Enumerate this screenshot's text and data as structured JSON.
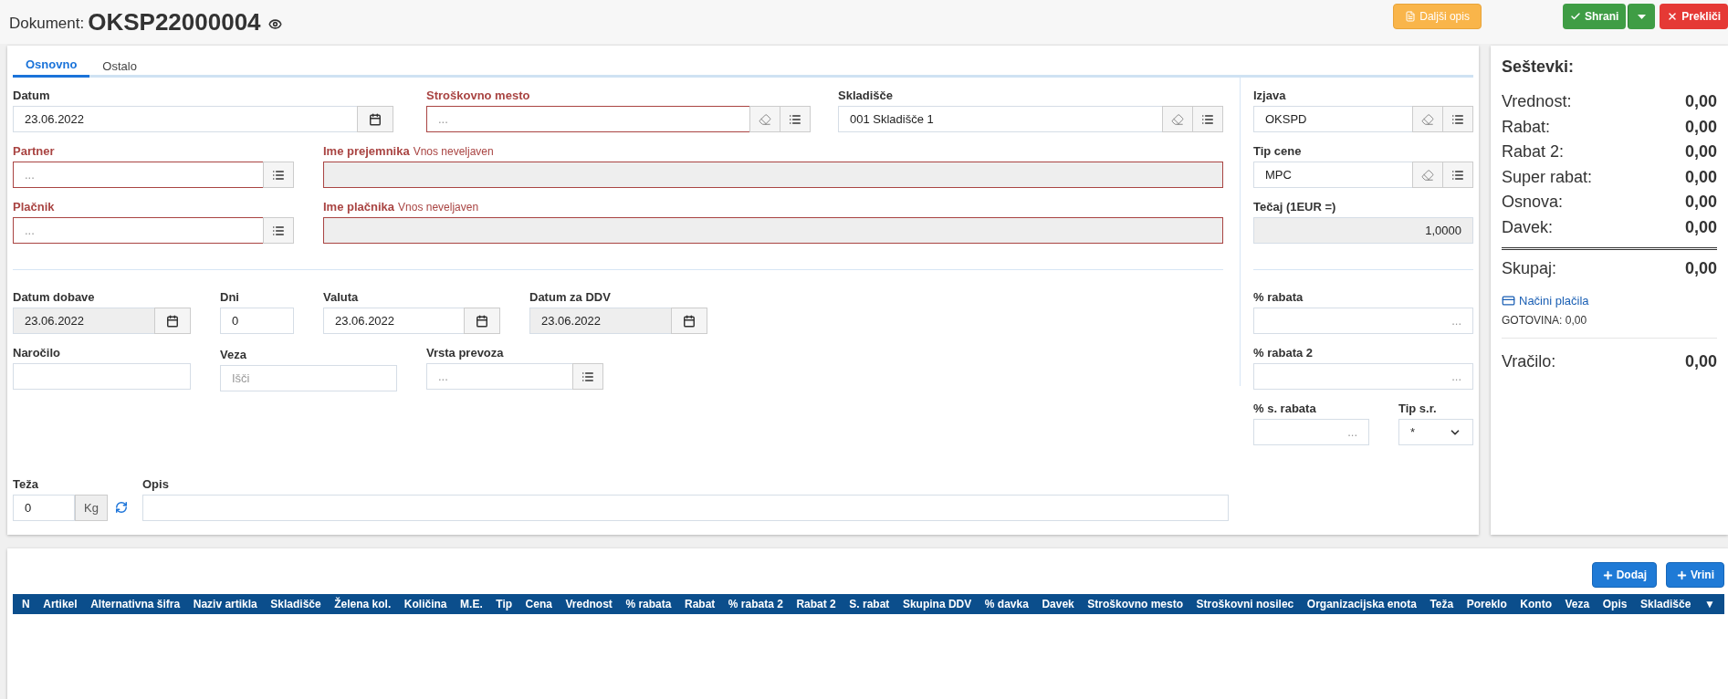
{
  "document": {
    "label": "Dokument:",
    "number": "OKSP22000004"
  },
  "header_buttons": [
    {
      "kind": "info",
      "label": "Daljši opis"
    },
    {
      "kind": "save",
      "label": "Shrani"
    },
    {
      "kind": "dropdown"
    },
    {
      "kind": "cancel",
      "label": "Prekliči"
    }
  ],
  "tabs": [
    {
      "label": "Osnovno",
      "selected": true
    },
    {
      "label": "Ostalo",
      "selected": false
    }
  ],
  "form": {
    "datum": {
      "label": "Datum",
      "value": "23.06.2022",
      "invalid": false,
      "readonly": false
    },
    "stroskovno_mesto": {
      "label": "Stroškovno mesto",
      "placeholder": "...",
      "invalid": true,
      "readonly": false
    },
    "skladisce": {
      "label": "Skladišče",
      "value": "001 Skladišče 1",
      "invalid": false,
      "readonly": false
    },
    "partner": {
      "label": "Partner",
      "placeholder": "...",
      "invalid": true,
      "readonly": false
    },
    "ime_prejemnika": {
      "label": "Ime prejemnika",
      "note": "Vnos neveljaven",
      "invalid": true,
      "readonly": true
    },
    "placnik": {
      "label": "Plačnik",
      "placeholder": "...",
      "invalid": true,
      "readonly": false
    },
    "ime_placnika": {
      "label": "Ime plačnika",
      "note": "Vnos neveljaven",
      "invalid": true,
      "readonly": true
    },
    "datum_dobave": {
      "label": "Datum dobave",
      "value": "23.06.2022",
      "invalid": false,
      "readonly": true
    },
    "dni": {
      "label": "Dni",
      "value": "0",
      "invalid": false,
      "readonly": false
    },
    "valuta": {
      "label": "Valuta",
      "value": "23.06.2022",
      "invalid": false,
      "readonly": false
    },
    "datum_za_ddv": {
      "label": "Datum za DDV",
      "value": "23.06.2022",
      "invalid": false,
      "readonly": true
    },
    "narocilo": {
      "label": "Naročilo",
      "invalid": false,
      "readonly": false
    },
    "veza": {
      "label": "Veza",
      "placeholder": "Išči",
      "invalid": false,
      "readonly": false
    },
    "vrsta_prevoza": {
      "label": "Vrsta prevoza",
      "placeholder": "...",
      "invalid": false,
      "readonly": false
    },
    "teza": {
      "label": "Teža",
      "value": "0",
      "unit": "Kg",
      "invalid": false,
      "readonly": false
    },
    "opis": {
      "label": "Opis",
      "invalid": false,
      "readonly": false
    }
  },
  "side": {
    "izjava": {
      "label": "Izjava",
      "value": "OKSPD",
      "invalid": false,
      "readonly": false
    },
    "tip_cene": {
      "label": "Tip cene",
      "value": "MPC",
      "invalid": false,
      "readonly": false
    },
    "tecaj": {
      "label": "Tečaj (1EUR =)",
      "value": "1,0000",
      "invalid": false,
      "readonly": true
    },
    "rabata": {
      "label": "% rabata",
      "placeholder": "...",
      "invalid": false,
      "readonly": false
    },
    "rabata_2": {
      "label": "% rabata 2",
      "placeholder": "...",
      "invalid": false,
      "readonly": false
    },
    "s_rabata": {
      "label": "% s. rabata",
      "placeholder": "...",
      "invalid": false,
      "readonly": false
    },
    "tip_sr": {
      "label": "Tip s.r.",
      "value": "*"
    }
  },
  "totals": {
    "title": "Seštevki:",
    "rows": [
      {
        "label": "Vrednost:",
        "value": "0,00"
      },
      {
        "label": "Rabat:",
        "value": "0,00"
      },
      {
        "label": "Rabat 2:",
        "value": "0,00"
      },
      {
        "label": "Super rabat:",
        "value": "0,00"
      },
      {
        "label": "Osnova:",
        "value": "0,00"
      },
      {
        "label": "Davek:",
        "value": "0,00"
      }
    ],
    "total": {
      "label": "Skupaj:",
      "value": "0,00"
    },
    "payment_link": "Načini plačila",
    "payment_note": "GOTOVINA: 0,00",
    "change": {
      "label": "Vračilo:",
      "value": "0,00"
    }
  },
  "table": {
    "buttons": [
      "Dodaj",
      "Vrini"
    ],
    "columns": [
      "N",
      "Artikel",
      "Alternativna šifra",
      "Naziv artikla",
      "Skladišče",
      "Želena kol.",
      "Količina",
      "M.E.",
      "Tip",
      "Cena",
      "Vrednost",
      "% rabata",
      "Rabat",
      "% rabata 2",
      "Rabat 2",
      "S. rabat",
      "Skupina DDV",
      "% davka",
      "Davek",
      "Stroškovno mesto",
      "Stroškovni nosilec",
      "Organizacijska enota",
      "Teža",
      "Poreklo",
      "Konto",
      "Veza",
      "Opis",
      "Skladišče"
    ],
    "column_menu": "▼"
  }
}
